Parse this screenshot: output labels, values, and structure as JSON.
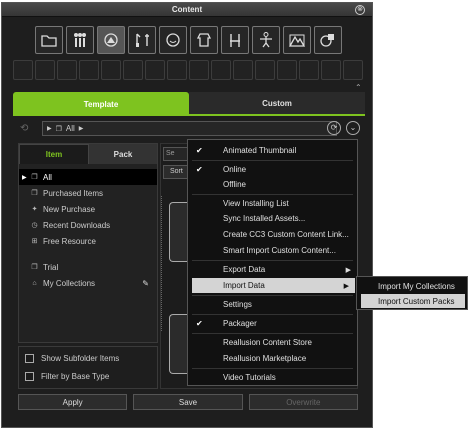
{
  "window": {
    "title": "Content",
    "close_glyph": "⊗"
  },
  "category_icons": [
    "folder-icon",
    "figure-group-icon",
    "shoe-icon",
    "paint-icon",
    "head-icon",
    "body-icon",
    "chair-icon",
    "skeleton-icon",
    "terrain-icon",
    "shapes-icon"
  ],
  "collapse_glyph": "⌃",
  "tabs": [
    {
      "label": "Template",
      "active": true
    },
    {
      "label": "Custom",
      "active": false
    }
  ],
  "nav": {
    "path": "All",
    "back_glyph": "⟲",
    "refresh_glyph": "⟳",
    "menu_glyph": "⌄"
  },
  "left_panel": {
    "tabs": [
      {
        "label": "Item",
        "active": true
      },
      {
        "label": "Pack",
        "active": false
      }
    ],
    "tree": [
      {
        "label": "All",
        "selected": true,
        "icon": "stack-icon"
      },
      {
        "label": "Purchased Items",
        "selected": false,
        "icon": "stack-icon"
      },
      {
        "label": "New Purchase",
        "selected": false,
        "icon": "star-icon"
      },
      {
        "label": "Recent Downloads",
        "selected": false,
        "icon": "clock-icon"
      },
      {
        "label": "Free Resource",
        "selected": false,
        "icon": "gift-icon"
      },
      {
        "label": "Trial",
        "selected": false,
        "icon": "stack-icon"
      },
      {
        "label": "My Collections",
        "selected": false,
        "icon": "tag-icon"
      }
    ],
    "options": [
      {
        "label": "Show Subfolder Items",
        "checked": false
      },
      {
        "label": "Filter by Base Type",
        "checked": false
      }
    ]
  },
  "right_panel": {
    "search_fragment": "Se",
    "sort_fragment": "Sort"
  },
  "context_menu": {
    "items": [
      {
        "label": "Animated Thumbnail",
        "checked": true,
        "submenu": false,
        "highlighted": false
      },
      {
        "label": "Online",
        "checked": true,
        "submenu": false,
        "highlighted": false
      },
      {
        "label": "Offline",
        "checked": false,
        "submenu": false,
        "highlighted": false
      },
      {
        "label": "View Installing List",
        "checked": false,
        "submenu": false,
        "highlighted": false
      },
      {
        "label": "Sync Installed Assets...",
        "checked": false,
        "submenu": false,
        "highlighted": false
      },
      {
        "label": "Create CC3 Custom Content Link...",
        "checked": false,
        "submenu": false,
        "highlighted": false
      },
      {
        "label": "Smart Import Custom Content...",
        "checked": false,
        "submenu": false,
        "highlighted": false
      },
      {
        "label": "Export Data",
        "checked": false,
        "submenu": true,
        "highlighted": false
      },
      {
        "label": "Import Data",
        "checked": false,
        "submenu": true,
        "highlighted": true
      },
      {
        "label": "Settings",
        "checked": false,
        "submenu": false,
        "highlighted": false
      },
      {
        "label": "Packager",
        "checked": true,
        "submenu": false,
        "highlighted": false
      },
      {
        "label": "Reallusion Content Store",
        "checked": false,
        "submenu": false,
        "highlighted": false
      },
      {
        "label": "Reallusion Marketplace",
        "checked": false,
        "submenu": false,
        "highlighted": false
      },
      {
        "label": "Video Tutorials",
        "checked": false,
        "submenu": false,
        "highlighted": false
      }
    ],
    "check_glyph": "✔",
    "submenu_glyph": "▶"
  },
  "import_submenu": {
    "items": [
      {
        "label": "Import My Collections",
        "highlighted": false
      },
      {
        "label": "Import Custom Packs",
        "highlighted": true
      }
    ]
  },
  "actions": [
    {
      "label": "Apply",
      "enabled": true
    },
    {
      "label": "Save",
      "enabled": true
    },
    {
      "label": "Overwrite",
      "enabled": false
    }
  ],
  "colors": {
    "accent": "#7ec31f",
    "background": "#1e1e1e",
    "menu_highlight": "#d4d4d4"
  }
}
